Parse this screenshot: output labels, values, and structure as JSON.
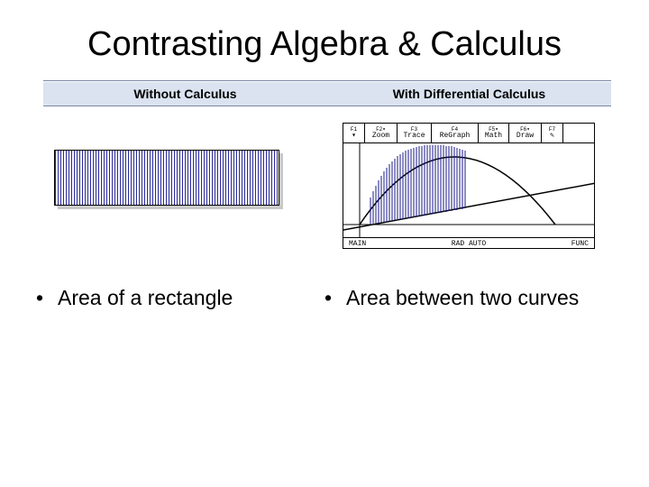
{
  "title": "Contrasting Algebra & Calculus",
  "headers": {
    "left": "Without Calculus",
    "right": "With Differential Calculus"
  },
  "calculator": {
    "menu": [
      {
        "fkey": "F1",
        "label": "▾"
      },
      {
        "fkey": "F2▾",
        "label": "Zoom"
      },
      {
        "fkey": "F3",
        "label": "Trace"
      },
      {
        "fkey": "F4",
        "label": "ReGraph"
      },
      {
        "fkey": "F5▾",
        "label": "Math"
      },
      {
        "fkey": "F6▾",
        "label": "Draw"
      },
      {
        "fkey": "F7",
        "label": "✎"
      },
      {
        "fkey": "",
        "label": ""
      }
    ],
    "status": {
      "left": "MAIN",
      "center": "RAD AUTO",
      "right": "FUNC"
    }
  },
  "bullets": {
    "left": "Area of a rectangle",
    "right": "Area between two curves"
  }
}
